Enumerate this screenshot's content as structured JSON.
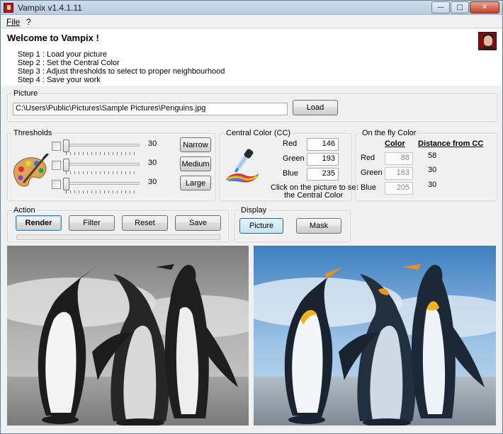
{
  "window": {
    "title": "Vampix v1.4.1.11"
  },
  "menu": {
    "file": "File",
    "help": "?"
  },
  "welcome": {
    "title": "Welcome to Vampix !",
    "steps": [
      "Step 1 : Load your picture",
      "Step 2 : Set the Central Color",
      "Step 3 : Adjust thresholds to select to proper neighbourhood",
      "Step 4 : Save your work"
    ]
  },
  "picture": {
    "label": "Picture",
    "path": "C:\\Users\\Public\\Pictures\\Sample Pictures\\Penguins.jpg",
    "load_button": "Load"
  },
  "thresholds": {
    "label": "Thresholds",
    "sliders": [
      {
        "value": "30",
        "fraction": 0.0
      },
      {
        "value": "30",
        "fraction": 0.0
      },
      {
        "value": "30",
        "fraction": 0.0
      }
    ],
    "buttons": [
      "Narrow",
      "Medium",
      "Large"
    ]
  },
  "central_color": {
    "label": "Central Color (CC)",
    "red_label": "Red",
    "red": "146",
    "green_label": "Green",
    "green": "193",
    "blue_label": "Blue",
    "blue": "235",
    "hint_line1": "Click on the picture to set",
    "hint_line2": "the Central Color"
  },
  "on_the_fly": {
    "label": "On the fly Color",
    "color_header": "Color",
    "distance_header": "Distance from CC",
    "rows": [
      {
        "label": "Red",
        "value": "88",
        "distance": "58"
      },
      {
        "label": "Green",
        "value": "163",
        "distance": "30"
      },
      {
        "label": "Blue",
        "value": "205",
        "distance": "30"
      }
    ]
  },
  "action": {
    "label": "Action",
    "render": "Render",
    "filter": "Filter",
    "reset": "Reset",
    "save": "Save"
  },
  "display": {
    "label": "Display",
    "picture": "Picture",
    "mask": "Mask"
  },
  "colors": {
    "accent": "#3c7fb1",
    "window_bg": "#f0f0f0",
    "central_color_swatch": "#92c1eb"
  },
  "icons": {
    "palette": "palette-icon",
    "dropper": "color-dropper-icon",
    "app": "vampix-app-icon"
  }
}
